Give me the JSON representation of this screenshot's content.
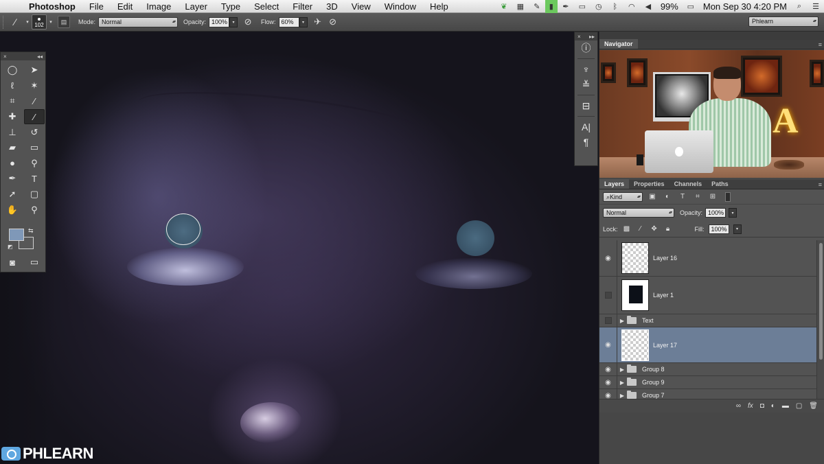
{
  "menubar": {
    "app_name": "Photoshop",
    "items": [
      "File",
      "Edit",
      "Image",
      "Layer",
      "Type",
      "Select",
      "Filter",
      "3D",
      "View",
      "Window",
      "Help"
    ],
    "battery": "99%",
    "clock": "Mon Sep 30  4:20 PM"
  },
  "options": {
    "brush_size": "102",
    "mode_label": "Mode:",
    "mode_value": "Normal",
    "opacity_label": "Opacity:",
    "opacity_value": "100%",
    "flow_label": "Flow:",
    "flow_value": "60%",
    "workspace": "Phlearn"
  },
  "colors": {
    "foreground": "#7f98b8",
    "background": "#575757",
    "selected_layer": "#6c7e97"
  },
  "panels": {
    "navigator_tab": "Navigator",
    "layers_tabs": [
      "Layers",
      "Properties",
      "Channels",
      "Paths"
    ]
  },
  "layers": {
    "filter_kind": "Kind",
    "blend_mode": "Normal",
    "opacity_label": "Opacity:",
    "opacity_value": "100%",
    "lock_label": "Lock:",
    "fill_label": "Fill:",
    "fill_value": "100%",
    "items": [
      {
        "name": "Layer 16",
        "visible": true,
        "type": "layer"
      },
      {
        "name": "Layer 1",
        "visible": false,
        "type": "layer"
      },
      {
        "name": "Text",
        "visible": false,
        "type": "group"
      },
      {
        "name": "Layer 17",
        "visible": true,
        "type": "layer",
        "selected": true
      },
      {
        "name": "Group 8",
        "visible": true,
        "type": "group"
      },
      {
        "name": "Group 9",
        "visible": true,
        "type": "group"
      },
      {
        "name": "Group 7",
        "visible": true,
        "type": "group"
      }
    ]
  },
  "watermark": "PHLEARN"
}
